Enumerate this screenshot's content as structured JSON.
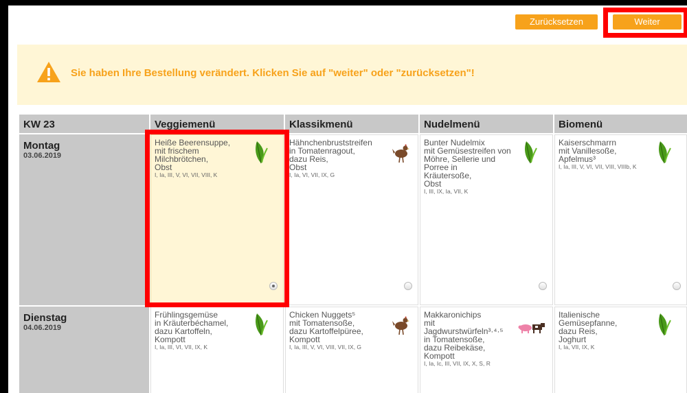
{
  "toolbar": {
    "reset_label": "Zurücksetzen",
    "next_label": "Weiter"
  },
  "banner": {
    "message": "Sie haben Ihre Bestellung verändert. Klicken Sie auf \"weiter\" oder \"zurücksetzen\"!"
  },
  "table": {
    "week_label": "KW 23",
    "columns": [
      "Veggiemenü",
      "Klassikmenü",
      "Nudelmenü",
      "Biomenü"
    ],
    "days": [
      {
        "name": "Montag",
        "date": "03.06.2019",
        "meals": [
          {
            "dish": "Heiße Beerensuppe,\nmit frischem\nMilchbrötchen,\nObst",
            "allergens": "I, Ia, III, V, VI, VII, VIII, K",
            "icon": "leaf-icon",
            "selected": true
          },
          {
            "dish": "Hähnchenbruststreifen\nin Tomatenragout,\ndazu Reis,\nObst",
            "allergens": "I, Ia, VI, VII, IX, G",
            "icon": "chicken-icon",
            "selected": false
          },
          {
            "dish": "Bunter Nudelmix\nmit Gemüsestreifen von\nMöhre, Sellerie und\nPorree in\nKräutersoße,\nObst",
            "allergens": "I, III, IX, Ia, VII, K",
            "icon": "leaf-icon",
            "selected": false
          },
          {
            "dish": "Kaiserschmarrn\nmit Vanillesoße,\nApfelmus³",
            "allergens": "I, Ia, III, V, VI, VII, VIII, VIIIb, K",
            "icon": "leaf-icon",
            "selected": false
          }
        ]
      },
      {
        "name": "Dienstag",
        "date": "04.06.2019",
        "meals": [
          {
            "dish": "Frühlingsgemüse\nin Kräuterbéchamel,\ndazu Kartoffeln,\nKompott",
            "allergens": "I, Ia, III, VI, VII, IX, K",
            "icon": "leaf-icon",
            "selected": false
          },
          {
            "dish": "Chicken Nuggets⁵\nmit Tomatensoße,\ndazu Kartoffelpüree,\nKompott",
            "allergens": "I, Ia, III, V, VI, VIII, VII, IX, G",
            "icon": "chicken-icon",
            "selected": false
          },
          {
            "dish": "Makkaronichips\nmit\nJagdwurstwürfeln³·⁴·⁵\nin Tomatensoße,\ndazu Reibekäse,\nKompott",
            "allergens": "I, Ia, Ic, III, VII, IX, X, S, R",
            "icon": "pig-cow-icon",
            "selected": false
          },
          {
            "dish": "Italienische\nGemüsepfanne,\ndazu Reis,\nJoghurt",
            "allergens": "I, Ia, VII, IX, K",
            "icon": "leaf-icon",
            "selected": false
          }
        ]
      }
    ]
  },
  "colors": {
    "accent": "#f7a21b",
    "banner_bg": "#fff6d6",
    "highlight": "#ff0000",
    "header_bg": "#c8c8c8",
    "leaf": "#4a9a1a",
    "chicken": "#7a4a2a",
    "pig": "#ee82a8"
  }
}
